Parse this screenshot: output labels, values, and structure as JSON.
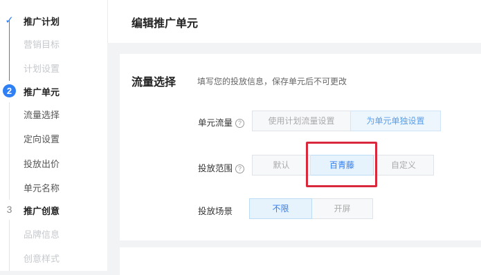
{
  "sidebar": {
    "step1": {
      "indicator": "✓",
      "label": "推广计划",
      "subs": [
        "营销目标",
        "计划设置"
      ]
    },
    "step2": {
      "indicator": "2",
      "label": "推广单元",
      "subs": [
        "流量选择",
        "定向设置",
        "投放出价",
        "单元名称"
      ]
    },
    "step3": {
      "indicator": "3",
      "label": "推广创意",
      "subs": [
        "品牌信息",
        "创意样式"
      ]
    }
  },
  "header": {
    "title": "编辑推广单元"
  },
  "section": {
    "title": "流量选择",
    "description": "填写您的投放信息，保存单元后不可更改",
    "help_icon": "question-circle-icon",
    "rows": {
      "traffic": {
        "label": "单元流量",
        "options": [
          "使用计划流量设置",
          "为单元单独设置"
        ],
        "selected": "为单元单独设置"
      },
      "scope": {
        "label": "投放范围",
        "options": [
          "默认",
          "百青藤",
          "自定义"
        ],
        "selected": "百青藤"
      },
      "scene": {
        "label": "投放场景",
        "options": [
          "不限",
          "开屏"
        ],
        "selected": "不限"
      }
    }
  },
  "colors": {
    "accent": "#2f7ff5",
    "highlight": "#d9283c"
  }
}
